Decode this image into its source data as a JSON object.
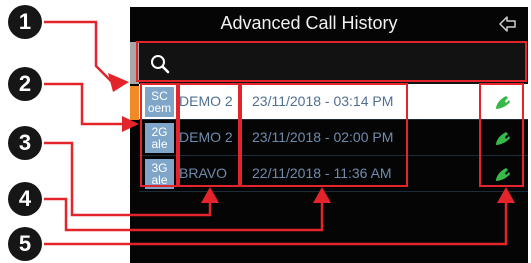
{
  "header": {
    "title": "Advanced Call History"
  },
  "search": {
    "value": "",
    "placeholder": ""
  },
  "rows": [
    {
      "badge_top": "SC",
      "badge_bottom": "oem",
      "name": "DEMO 2",
      "datetime": "23/11/2018 - 03:14 PM",
      "selected": true
    },
    {
      "badge_top": "2G",
      "badge_bottom": "ale",
      "name": "DEMO 2",
      "datetime": "23/11/2018 - 02:00 PM",
      "selected": false
    },
    {
      "badge_top": "3G",
      "badge_bottom": "ale",
      "name": "BRAVO",
      "datetime": "22/11/2018 - 11:36 AM",
      "selected": false
    }
  ],
  "callouts": [
    "1",
    "2",
    "3",
    "4",
    "5"
  ],
  "colors": {
    "highlight": "#e3242b",
    "badge": "#7fa6c8",
    "call_icon": "#39b84a",
    "tab_orange": "#f08a26",
    "tab_gray": "#a8a8a8"
  },
  "icons": {
    "search": "search-icon",
    "back": "back-arrow-icon",
    "call": "phone-handset-icon"
  }
}
